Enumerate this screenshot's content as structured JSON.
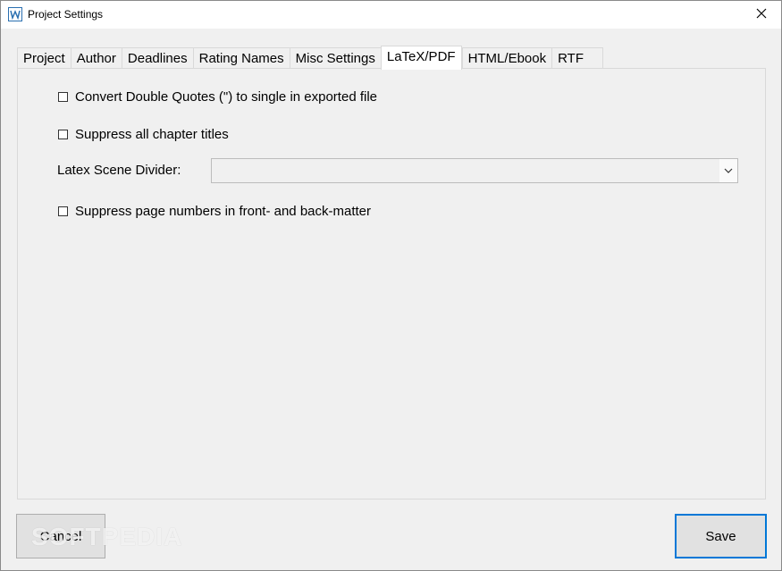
{
  "window": {
    "title": "Project Settings"
  },
  "tabs": [
    {
      "label": "Project"
    },
    {
      "label": "Author"
    },
    {
      "label": "Deadlines"
    },
    {
      "label": "Rating Names"
    },
    {
      "label": "Misc Settings"
    },
    {
      "label": "LaTeX/PDF",
      "active": true
    },
    {
      "label": "HTML/Ebook"
    },
    {
      "label": "RTF"
    }
  ],
  "latex": {
    "convert_quotes": {
      "label": "Convert Double Quotes (\") to single in exported file",
      "checked": false
    },
    "suppress_chapter_titles": {
      "label": "Suppress all chapter titles",
      "checked": false
    },
    "scene_divider": {
      "label": "Latex Scene Divider:",
      "value": ""
    },
    "suppress_page_numbers": {
      "label": "Suppress page numbers in front- and back-matter",
      "checked": false
    }
  },
  "buttons": {
    "cancel": "Cancel",
    "save": "Save"
  },
  "watermark": "SOFTPEDIA",
  "colors": {
    "accent": "#0078d7",
    "background": "#f0f0f0",
    "titlebar": "#ffffff"
  },
  "icons": {
    "app": "app-logo-icon",
    "close": "close-icon",
    "dropdown": "chevron-down-icon"
  }
}
